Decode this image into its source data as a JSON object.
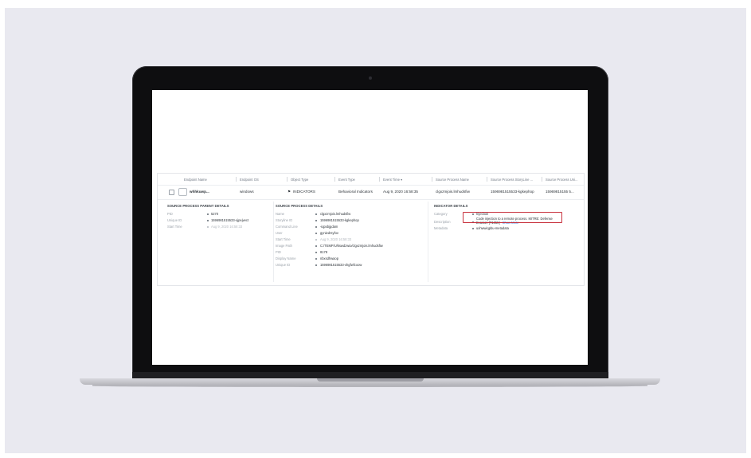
{
  "table": {
    "columns": [
      "Endpoint Name",
      "Endpoint OS",
      "Object Type",
      "Event Type",
      "Event Time ▾",
      "Source Process Name",
      "Source Process StoryLine ...",
      "Source Process Uni..."
    ],
    "row": {
      "endpoint_name": "whhkuwp...",
      "endpoint_os": "windows",
      "object_type": "INDICATORS",
      "event_type": "Behavioral Indicators",
      "event_time": "Aug 9, 2020 16:58:35",
      "source_process_name": "clgxzmjois.lmhudsfiw",
      "storyline": "1596981515533-kgkephop",
      "unique": "15969815155 5..."
    }
  },
  "parent": {
    "title": "SOURCE PROCESS PARENT DETAILS",
    "fields": [
      {
        "k": "PID",
        "v": "5270"
      },
      {
        "k": "Unique ID",
        "v": "1596981515533-ojpejvect"
      },
      {
        "k": "Start Time",
        "v": "Aug 9, 2020 16:58:33"
      }
    ]
  },
  "process": {
    "title": "SOURCE PROCESS DETAILS",
    "fields": [
      {
        "k": "Name",
        "v": "clgxzmjois.lmhudsfiw"
      },
      {
        "k": "Storyline ID",
        "v": "1596981515533-kgkephop"
      },
      {
        "k": "Command Line",
        "v": "-iqpxbjgdam"
      },
      {
        "k": "User",
        "v": "gyniedrsyfov"
      },
      {
        "k": "Start Time",
        "v": "Aug 9, 2020 16:58:33"
      },
      {
        "k": "Image Path",
        "v": "C:/TEMP/U/kswdzwio/clgxzmjois.lmhudsfiw"
      },
      {
        "k": "PID",
        "v": "8178"
      },
      {
        "k": "Display Name",
        "v": "nbxsdhwaop"
      },
      {
        "k": "Unique ID",
        "v": "1596981515533-xhgfwfcoow"
      }
    ]
  },
  "indicator": {
    "title": "INDICATOR DETAILS",
    "category_label": "Category",
    "category": "Injection",
    "description_label": "Description",
    "description_line1": "Code injection to a remote process. MITRE: Defense",
    "description_line2": "Evasion [T1055]",
    "show_more": "Show More",
    "metadata_label": "Metadata",
    "metadata": "uxhwwiqpbu-metadata"
  },
  "colors": {
    "highlight": "#c8323e",
    "link": "#2f6fd6"
  }
}
